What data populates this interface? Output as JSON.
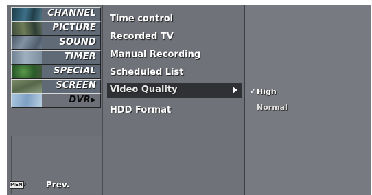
{
  "categories": [
    {
      "label": "CHANNEL",
      "icon": "channel-thumbnail-icon",
      "thumb": "#2f5a6c"
    },
    {
      "label": "PICTURE",
      "icon": "picture-thumbnail-icon",
      "thumb": "#4a5e4a"
    },
    {
      "label": "SOUND",
      "icon": "sound-thumbnail-icon",
      "thumb": "#5a6a7a"
    },
    {
      "label": "TIMER",
      "icon": "timer-thumbnail-icon",
      "thumb": "#7a8c9e"
    },
    {
      "label": "SPECIAL",
      "icon": "special-thumbnail-icon",
      "thumb": "#3b6b3a"
    },
    {
      "label": "SCREEN",
      "icon": "screen-thumbnail-icon",
      "thumb": "#6a7e5a"
    },
    {
      "label": "DVR",
      "icon": "dvr-thumbnail-icon",
      "thumb": "#8aa6c4"
    }
  ],
  "active_category_arrow": "▶",
  "submenu": [
    {
      "label": "Time control"
    },
    {
      "label": "Recorded TV"
    },
    {
      "label": "Manual Recording"
    },
    {
      "label": "Scheduled List"
    },
    {
      "label": "Video Quality"
    },
    {
      "label": "HDD Format"
    }
  ],
  "options": [
    {
      "check": "✓",
      "label": "High"
    },
    {
      "check": "",
      "label": "Normal"
    }
  ],
  "footer": {
    "menu_key": "MENU",
    "prev_label": "Prev."
  },
  "colors": {
    "screen_bg": "#6f7279",
    "selected_row": "#2f3135",
    "text": "#ffffff"
  }
}
